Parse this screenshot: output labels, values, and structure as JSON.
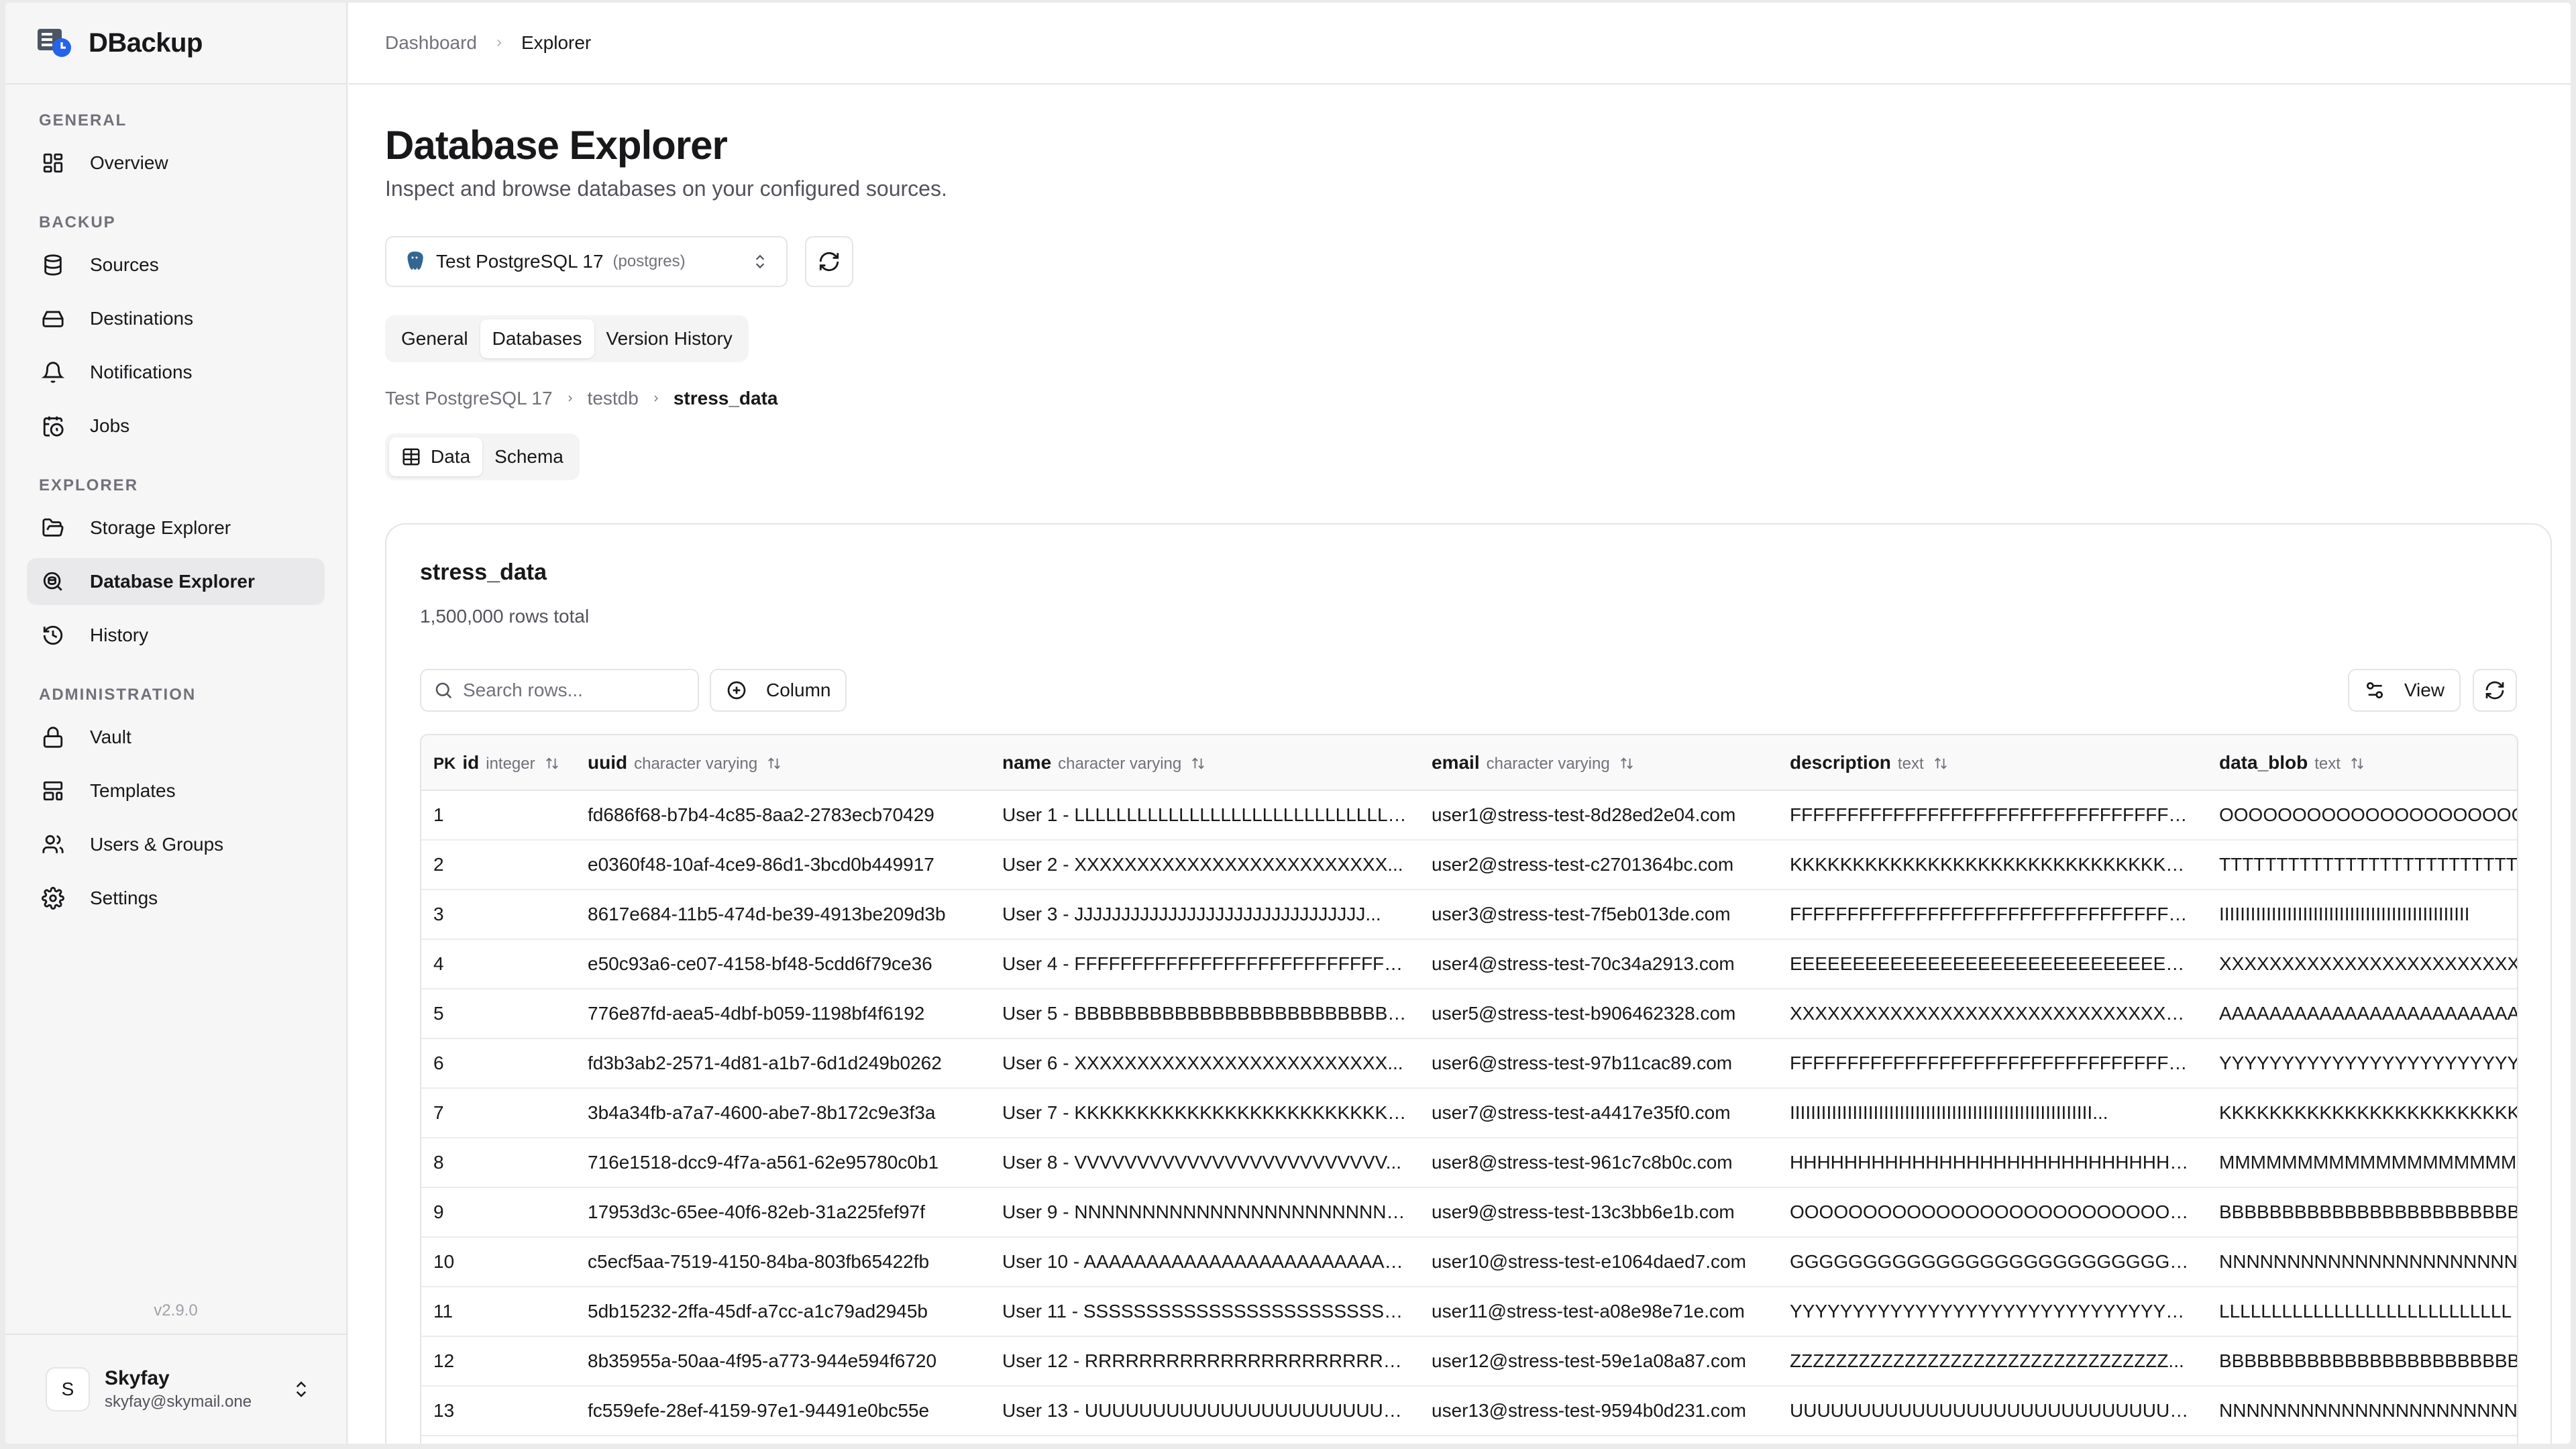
{
  "app": {
    "name": "DBackup",
    "version": "v2.9.0"
  },
  "sidebar": {
    "groups": [
      {
        "label": "GENERAL",
        "items": [
          {
            "label": "Overview",
            "icon": "grid-icon"
          }
        ]
      },
      {
        "label": "BACKUP",
        "items": [
          {
            "label": "Sources",
            "icon": "database-icon"
          },
          {
            "label": "Destinations",
            "icon": "hard-drive-icon"
          },
          {
            "label": "Notifications",
            "icon": "bell-icon"
          },
          {
            "label": "Jobs",
            "icon": "calendar-clock-icon"
          }
        ]
      },
      {
        "label": "EXPLORER",
        "items": [
          {
            "label": "Storage Explorer",
            "icon": "folder-open-icon"
          },
          {
            "label": "Database Explorer",
            "icon": "search-database-icon",
            "active": true
          },
          {
            "label": "History",
            "icon": "history-icon"
          }
        ]
      },
      {
        "label": "ADMINISTRATION",
        "items": [
          {
            "label": "Vault",
            "icon": "lock-icon"
          },
          {
            "label": "Templates",
            "icon": "layout-template-icon"
          },
          {
            "label": "Users & Groups",
            "icon": "users-icon"
          },
          {
            "label": "Settings",
            "icon": "gear-icon"
          }
        ]
      }
    ],
    "user": {
      "initial": "S",
      "name": "Skyfay",
      "email": "skyfay@skymail.one"
    }
  },
  "topbar": {
    "crumbs": [
      "Dashboard",
      "Explorer"
    ]
  },
  "page": {
    "title": "Database Explorer",
    "subtitle": "Inspect and browse databases on your configured sources.",
    "source": {
      "name": "Test PostgreSQL 17",
      "type": "(postgres)"
    },
    "tabs": [
      "General",
      "Databases",
      "Version History"
    ],
    "active_tab": "Databases",
    "db_path": [
      "Test PostgreSQL 17",
      "testdb",
      "stress_data"
    ],
    "view_tabs": [
      "Data",
      "Schema"
    ],
    "active_view_tab": "Data"
  },
  "table": {
    "name": "stress_data",
    "row_count": "1,500,000 rows total",
    "search_placeholder": "Search rows...",
    "column_btn": "Column",
    "view_btn": "View",
    "columns": [
      {
        "pk": "PK",
        "name": "id",
        "type": "integer"
      },
      {
        "name": "uuid",
        "type": "character varying"
      },
      {
        "name": "name",
        "type": "character varying"
      },
      {
        "name": "email",
        "type": "character varying"
      },
      {
        "name": "description",
        "type": "text"
      },
      {
        "name": "data_blob",
        "type": "text"
      }
    ],
    "rows": [
      [
        "1",
        "fd686f68-b7b4-4c85-8aa2-2783ecb70429",
        "User 1 - LLLLLLLLLLLLLLLLLLLLLLLLLLLLLLLL...",
        "user1@stress-test-8d28ed2e04.com",
        "FFFFFFFFFFFFFFFFFFFFFFFFFFFFFFFFFFFF...",
        "OOOOOOOOOOOOOOOOOOOOOOOOOOOO"
      ],
      [
        "2",
        "e0360f48-10af-4ce9-86d1-3bcd0b449917",
        "User 2 - XXXXXXXXXXXXXXXXXXXXXXXXX...",
        "user2@stress-test-c2701364bc.com",
        "KKKKKKKKKKKKKKKKKKKKKKKKKKKKKKKKK...",
        "TTTTTTTTTTTTTTTTTTTTTTTTTTTT"
      ],
      [
        "3",
        "8617e684-11b5-474d-be39-4913be209d3b",
        "User 3 - JJJJJJJJJJJJJJJJJJJJJJJJJJJJJJJ...",
        "user3@stress-test-7f5eb013de.com",
        "FFFFFFFFFFFFFFFFFFFFFFFFFFFFFFFFFFFF...",
        "IIIIIIIIIIIIIIIIIIIIIIIIIIIIIIIIIIIIIIIIIIIIIIII"
      ],
      [
        "4",
        "e50c93a6-ce07-4158-bf48-5cdd6f79ce36",
        "User 4 - FFFFFFFFFFFFFFFFFFFFFFFFFFFF...",
        "user4@stress-test-70c34a2913.com",
        "EEEEEEEEEEEEEEEEEEEEEEEEEEEEEEEEEE...",
        "XXXXXXXXXXXXXXXXXXXXXXXXXXXX"
      ],
      [
        "5",
        "776e87fd-aea5-4dbf-b059-1198bf4f6192",
        "User 5 - BBBBBBBBBBBBBBBBBBBBBBBBBB...",
        "user5@stress-test-b906462328.com",
        "XXXXXXXXXXXXXXXXXXXXXXXXXXXXXXXX...",
        "AAAAAAAAAAAAAAAAAAAAAAAAAAAA"
      ],
      [
        "6",
        "fd3b3ab2-2571-4d81-a1b7-6d1d249b0262",
        "User 6 - XXXXXXXXXXXXXXXXXXXXXXXXX...",
        "user6@stress-test-97b11cac89.com",
        "FFFFFFFFFFFFFFFFFFFFFFFFFFFFFFFFFFFF...",
        "YYYYYYYYYYYYYYYYYYYYYYYYYYYY"
      ],
      [
        "7",
        "3b4a34fb-a7a7-4600-abe7-8b172c9e3f3a",
        "User 7 - KKKKKKKKKKKKKKKKKKKKKKKKKK...",
        "user7@stress-test-a4417e35f0.com",
        "IIIIIIIIIIIIIIIIIIIIIIIIIIIIIIIIIIIIIIIIIIIIIIIIIIIIIIIIII...",
        "KKKKKKKKKKKKKKKKKKKKKKKKKKKK"
      ],
      [
        "8",
        "716e1518-dcc9-4f7a-a561-62e95780c0b1",
        "User 8 - VVVVVVVVVVVVVVVVVVVVVVVVV...",
        "user8@stress-test-961c7c8b0c.com",
        "HHHHHHHHHHHHHHHHHHHHHHHHHHHHHHH...",
        "MMMMMMMMMMMMMMMMMMMMMMMMMMMM"
      ],
      [
        "9",
        "17953d3c-65ee-40f6-82eb-31a225fef97f",
        "User 9 - NNNNNNNNNNNNNNNNNNNNNNNNN...",
        "user9@stress-test-13c3bb6e1b.com",
        "OOOOOOOOOOOOOOOOOOOOOOOOOOOO...",
        "BBBBBBBBBBBBBBBBBBBBBBBBBBBB"
      ],
      [
        "10",
        "c5ecf5aa-7519-4150-84ba-803fb65422fb",
        "User 10 - AAAAAAAAAAAAAAAAAAAAAAAAA...",
        "user10@stress-test-e1064daed7.com",
        "GGGGGGGGGGGGGGGGGGGGGGGGGGGGG...",
        "NNNNNNNNNNNNNNNNNNNNNNNNNNNN"
      ],
      [
        "11",
        "5db15232-2ffa-45df-a7cc-a1c79ad2945b",
        "User 11 - SSSSSSSSSSSSSSSSSSSSSSSSSSS...",
        "user11@stress-test-a08e98e71e.com",
        "YYYYYYYYYYYYYYYYYYYYYYYYYYYYYYYYYY...",
        "LLLLLLLLLLLLLLLLLLLLLLLLLLLL"
      ],
      [
        "12",
        "8b35955a-50aa-4f95-a773-944e594f6720",
        "User 12 - RRRRRRRRRRRRRRRRRRRRRRRRR...",
        "user12@stress-test-59e1a08a87.com",
        "ZZZZZZZZZZZZZZZZZZZZZZZZZZZZZZZZZ...",
        "BBBBBBBBBBBBBBBBBBBBBBBBBBBB"
      ],
      [
        "13",
        "fc559efe-28ef-4159-97e1-94491e0bc55e",
        "User 13 - UUUUUUUUUUUUUUUUUUUUUUUU...",
        "user13@stress-test-9594b0d231.com",
        "UUUUUUUUUUUUUUUUUUUUUUUUUUUUUUUU...",
        "NNNNNNNNNNNNNNNNNNNNNNNNNNNN"
      ]
    ]
  },
  "colors": {
    "accent_bg": "#e9e9eb",
    "border": "#e4e4e7",
    "muted_text": "#71717a"
  }
}
